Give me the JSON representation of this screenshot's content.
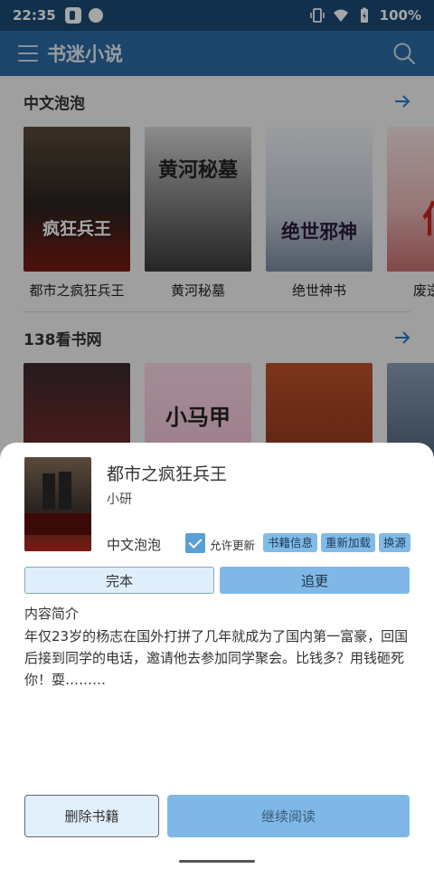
{
  "status_bar": {
    "time": "22:35",
    "battery": "100%",
    "icons": [
      "app-notification-icon",
      "dot-icon",
      "vibrate-icon",
      "wifi-icon",
      "battery-icon"
    ]
  },
  "toolbar": {
    "title": "书迷小说",
    "menu_icon": "menu-icon",
    "search_icon": "search-icon"
  },
  "sections": [
    {
      "title": "中文泡泡",
      "books": [
        {
          "name": "都市之疯狂兵王",
          "cover_text": "疯狂兵王"
        },
        {
          "name": "黄河秘墓",
          "cover_text": "黄河秘墓"
        },
        {
          "name": "绝世神书",
          "cover_text": "绝世邪神"
        },
        {
          "name": "废逆成福",
          "cover_text": "仙"
        }
      ]
    },
    {
      "title": "138看书网",
      "books": [
        {
          "name": "",
          "cover_text": ""
        },
        {
          "name": "",
          "cover_text": "小马甲"
        },
        {
          "name": "",
          "cover_text": ""
        },
        {
          "name": "",
          "cover_text": ""
        }
      ]
    }
  ],
  "sheet": {
    "title": "都市之疯狂兵王",
    "author": "小研",
    "source": "中文泡泡",
    "allow_update_label": "允许更新",
    "allow_update_checked": true,
    "chips": [
      "书籍信息",
      "重新加载",
      "换源"
    ],
    "status_done": "完本",
    "status_follow": "追更",
    "intro_label": "内容简介",
    "intro_text": "年仅23岁的杨志在国外打拼了几年就成为了国内第一富豪，回国后接到同学的电话，邀请他去参加同学聚会。比钱多？用钱砸死你！耍………",
    "delete_button": "删除书籍",
    "read_button": "继续阅读"
  },
  "colors": {
    "status_bar": "#1a4a73",
    "toolbar": "#2a6aa3",
    "accent": "#7fb8e6"
  }
}
